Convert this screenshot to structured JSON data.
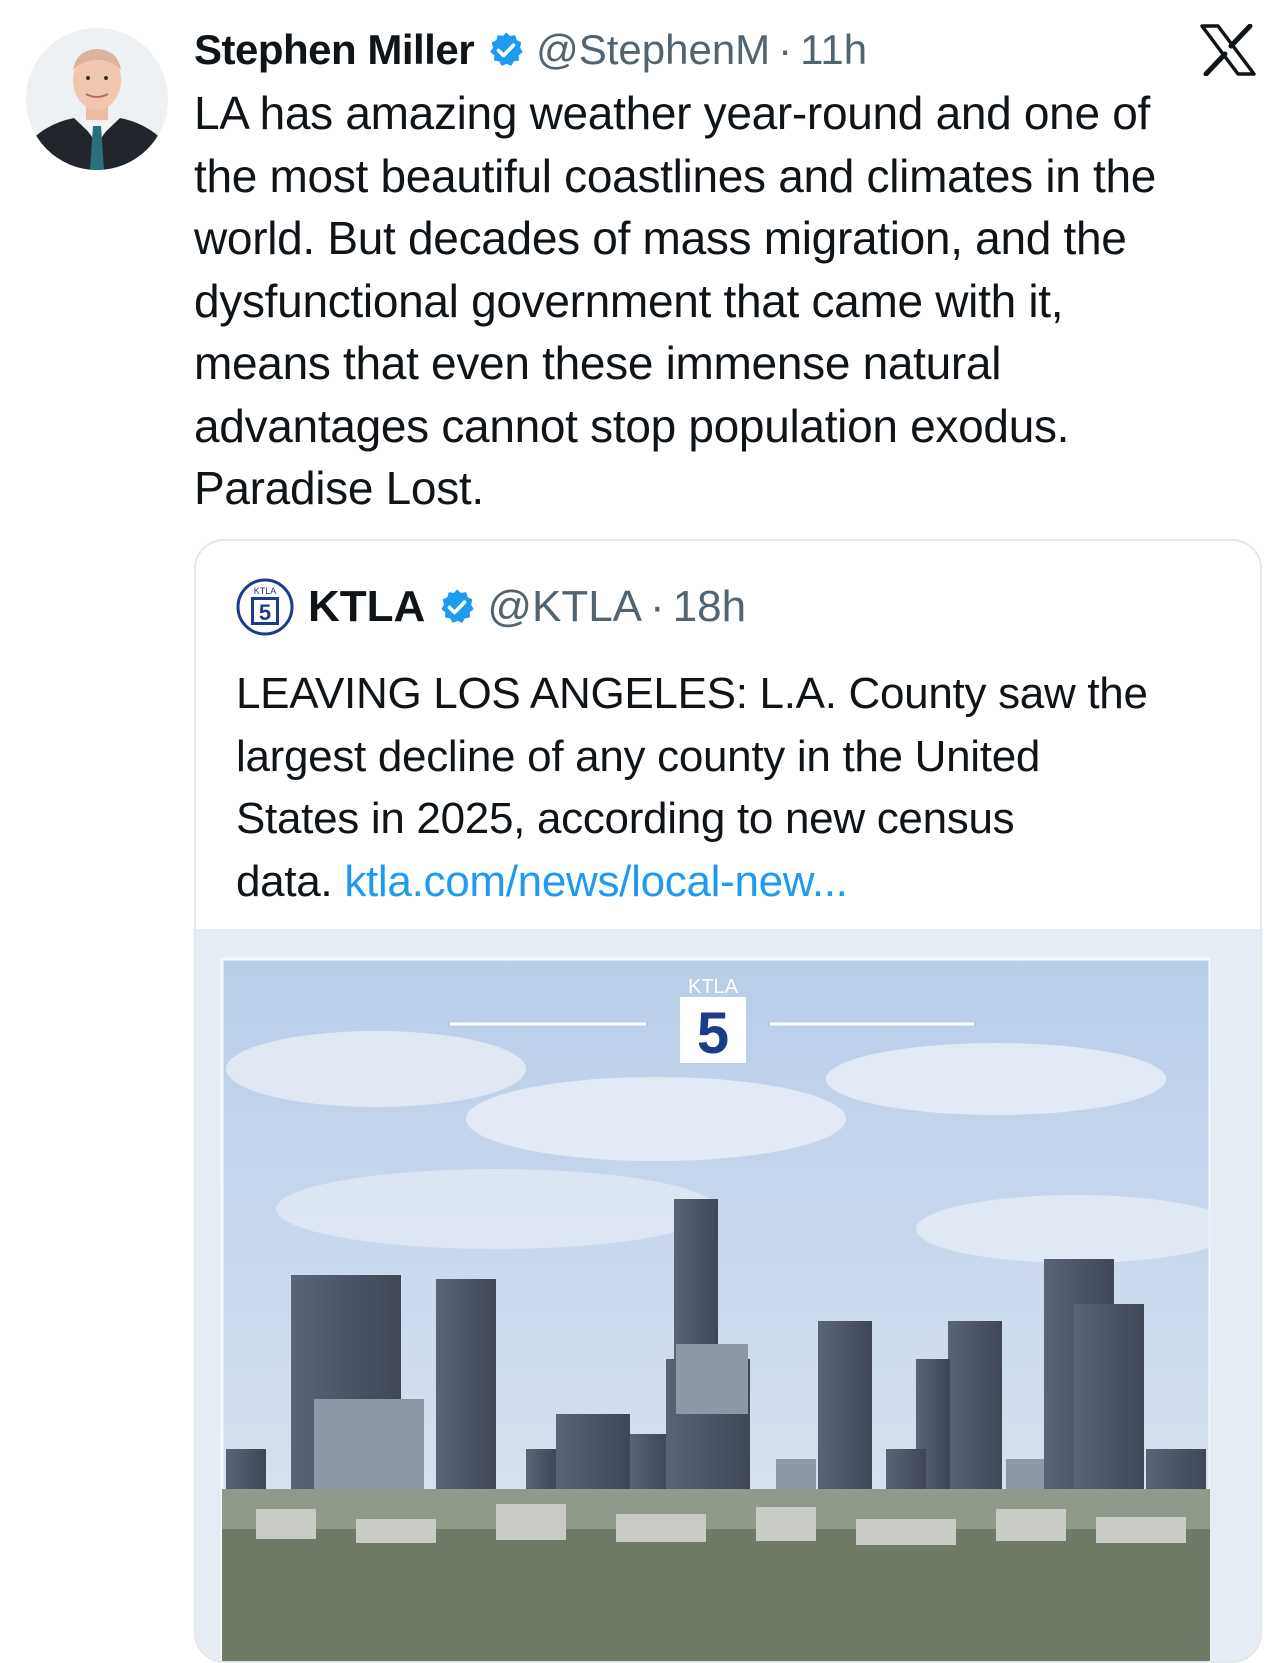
{
  "tweet": {
    "author": {
      "name": "Stephen Miller",
      "handle": "@StephenM",
      "time": "11h",
      "verified": true,
      "avatar_icon": "profile-photo-man-in-suit"
    },
    "text_lines": [
      "LA has amazing weather year-round and one of",
      "the most beautiful coastlines and climates in the",
      "world. But decades of mass migration, and the",
      "dysfunctional government that came with it,",
      "means that even these immense natural",
      "advantages cannot stop population exodus.",
      "Paradise Lost."
    ]
  },
  "quoted": {
    "author": {
      "name": "KTLA",
      "handle": "@KTLA",
      "time": "18h",
      "verified": true,
      "logo_icon": "ktla-5-logo"
    },
    "text_lines": [
      "LEAVING LOS ANGELES: L.A. County saw the",
      "largest decline of any county in the United",
      "States in 2025, according to new census"
    ],
    "last_line_text": "data.",
    "link_text": "ktla.com/news/local-new...",
    "media": {
      "description_icon": "los-angeles-skyline-photo",
      "logo_small_text": "KTLA",
      "logo_number": "5"
    }
  },
  "separator": "·",
  "brand_icon": "x-logo-icon",
  "colors": {
    "text": "#0f1419",
    "muted": "#536471",
    "link": "#1d9bf0",
    "verified": "#1d9bf0",
    "border": "#e3e8ec",
    "ktla_blue": "#1e3a8a"
  }
}
